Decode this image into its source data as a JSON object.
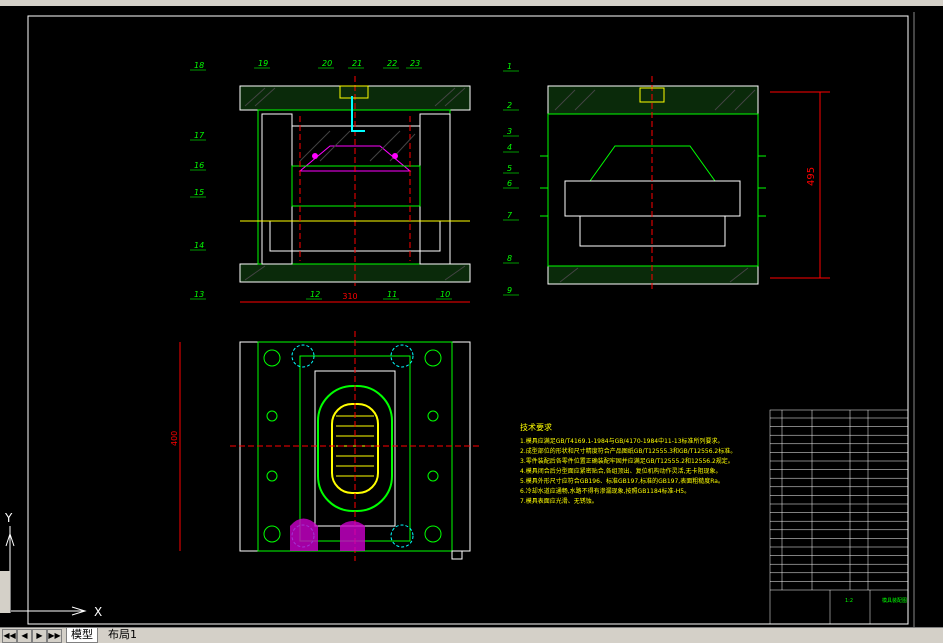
{
  "tabs": [
    {
      "label": "模型",
      "active": true
    },
    {
      "label": "布局1",
      "active": false
    }
  ],
  "balloons_left": [
    "18",
    "17",
    "16",
    "15",
    "14",
    "13"
  ],
  "balloons_top": [
    "19",
    "20",
    "21",
    "22",
    "23"
  ],
  "balloons_bottom": [
    "12",
    "11",
    "10"
  ],
  "balloons_right": [
    "1",
    "2",
    "3",
    "4",
    "5",
    "6",
    "7",
    "8",
    "9"
  ],
  "dimension_right": "495",
  "dimension_top": "310",
  "dimension_left": "400",
  "tech_title": "技术要求",
  "tech_lines": [
    "1.模具应满足GB/T4169.1-1984与GB/4170-1984中11-13标准所列要求。",
    "2.成型部位的形状和尺寸精度符合产品图纸GB/T12555.3和GB/T12556.2标准。",
    "3.零件装配后各零件位置正确装配牢固并应满足GB/T12555.2和12556.2规定。",
    "4.模具闭合后分型面应紧密贴合,各组顶出、复位机构动作灵活,无卡阻现象。",
    "5.模具外形尺寸应符合GB196、标准GB197,标准的GB197,表面粗糙度Ra。",
    "6.冷却水道应通畅,水路不得有渗漏现象,按照GB1184标准-H5。",
    "7.模具表面应光滑、无锈蚀。"
  ],
  "title_block": {
    "drawing_name": "模具装配图",
    "scale": "1:2"
  },
  "axis_labels": {
    "x": "X",
    "y": "Y"
  }
}
